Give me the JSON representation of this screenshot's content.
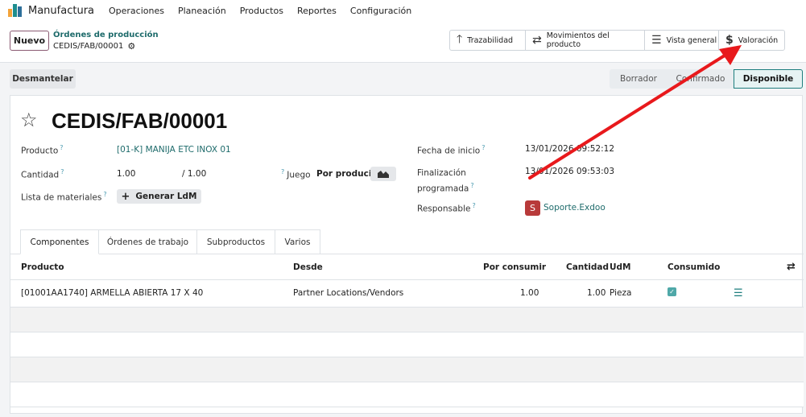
{
  "navbar": {
    "app_name": "Manufactura",
    "menu": [
      "Operaciones",
      "Planeación",
      "Productos",
      "Reportes",
      "Configuración"
    ]
  },
  "control": {
    "new_label": "Nuevo",
    "breadcrumb_parent": "Órdenes de producción",
    "breadcrumb_current": "CEDIS/FAB/00001",
    "smart_buttons": [
      {
        "label": "Trazabilidad",
        "icon": "arrow-up-icon"
      },
      {
        "label": "Movimientos del producto",
        "icon": "transfer-icon"
      },
      {
        "label": "Vista general",
        "icon": "list-icon"
      },
      {
        "label": "Valoración",
        "icon": "dollar-icon"
      }
    ]
  },
  "status": {
    "dismantle_label": "Desmantelar",
    "stages": [
      "Borrador",
      "Confirmado",
      "Disponible"
    ],
    "active_stage": "Disponible"
  },
  "form": {
    "title": "CEDIS/FAB/00001",
    "product_label": "Producto",
    "product_value": "[01-K] MANIJA ETC INOX 01",
    "quantity_label": "Cantidad",
    "quantity_value": "1.00",
    "quantity_total": "/ 1.00",
    "kit_label": "Juego",
    "kit_value": "Por producir",
    "bom_label": "Lista de materiales",
    "bom_button": "Generar LdM",
    "start_label": "Fecha de inicio",
    "start_value": "13/01/2026 09:52:12",
    "end_label_1": "Finalización",
    "end_label_2": "programada",
    "end_value": "13/01/2026 09:53:03",
    "responsible_label": "Responsable",
    "responsible_initial": "S",
    "responsible_value": "Soporte.Exdoo",
    "help_mark": "?"
  },
  "tabs": [
    "Componentes",
    "Órdenes de trabajo",
    "Subproductos",
    "Varios"
  ],
  "table": {
    "headers": {
      "product": "Producto",
      "from": "Desde",
      "to_consume": "Por consumir",
      "quantity": "Cantidad",
      "uom": "UdM",
      "consumed": "Consumido"
    },
    "rows": [
      {
        "product": "[01001AA1740] ARMELLA ABIERTA 17 X 40",
        "from": "Partner Locations/Vendors",
        "to_consume": "1.00",
        "quantity": "1.00",
        "uom": "Pieza",
        "consumed": true
      }
    ]
  },
  "colors": {
    "accent": "#1e7e7e",
    "annotation_arrow": "#e8191c",
    "brand_primary": "#714b67"
  }
}
